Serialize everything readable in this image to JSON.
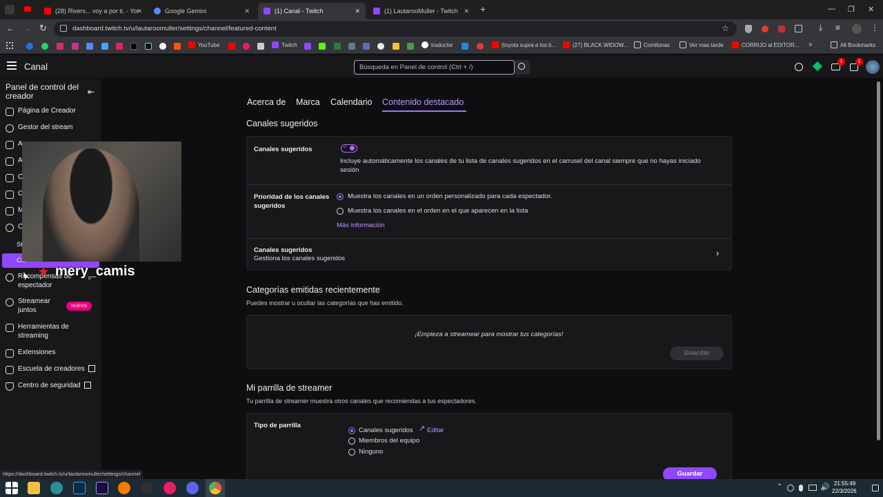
{
  "tabs": [
    {
      "label": "(28) Rivers... voy a por ti. - YouT",
      "color": "#ff0000"
    },
    {
      "label": "Google Gemini",
      "color": "#4f8df7"
    },
    {
      "label": "(1) Canal - Twitch",
      "color": "#9146ff"
    },
    {
      "label": "(1) LautarooMuller - Twitch",
      "color": "#9146ff"
    }
  ],
  "address": "dashboard.twitch.tv/u/lautaroomuller/settings/channel/featured-content",
  "bookmarks": [
    "YouTube",
    "Twitch",
    "traductor",
    "(toyota supra a los ti...",
    "(27) BLACK WIDOW...",
    "Comilonas",
    "Ver mas tarde",
    "CORRIJO al EDITOR...",
    "All Bookmarks"
  ],
  "topnav": {
    "title": "Canal",
    "search_placeholder": "Búsqueda en Panel de control (Ctrl + /)",
    "badge1": "1",
    "badge2": "1"
  },
  "sidebar": {
    "title": "Panel de control del creador",
    "items": [
      "Página de Creador",
      "Gestor del stream",
      "A",
      "A",
      "C",
      "C",
      "M",
      "C",
      "St",
      "Ca",
      "Recompensas de espectador",
      "Streamear juntos",
      "Herramientas de streaming",
      "Extensiones",
      "Escuela de creadores",
      "Centro de seguridad"
    ],
    "new_badge": "NUEVO"
  },
  "overlay_name": "mery_camis",
  "main": {
    "tabs": [
      "Acerca de",
      "Marca",
      "Calendario",
      "Contenido destacado"
    ],
    "section1": {
      "title": "Canales sugeridos",
      "toggle_label": "Canales sugeridos",
      "toggle_desc": "Incluye automáticamente los canales de tu lista de canales sugeridos en el carrusel del canal siempre que no hayas iniciado sesión",
      "priority_label": "Prioridad de los canales sugeridos",
      "opt1": "Muestra los canales en un orden personalizado para cada espectador.",
      "opt2": "Muestra los canales en el orden en el que aparecen en la lista",
      "more": "Más información",
      "manage_title": "Canales sugeridos",
      "manage_sub": "Gestiona los canales sugeridos"
    },
    "section2": {
      "title": "Categorías emitidas recientemente",
      "desc": "Puedes mostrar u ocultar las categorías que has emitido.",
      "empty": "¡Empieza a streamear para mostrar tus categorías!",
      "save": "Guardar"
    },
    "section3": {
      "title": "Mi parrilla de streamer",
      "desc": "Tu parrilla de streamer muestra otros canales que recomiendas a tus espectadores.",
      "type_label": "Tipo de parrilla",
      "opt1": "Canales sugeridos",
      "edit": "Editar",
      "opt2": "Miembros del equipo",
      "opt3": "Ninguno",
      "save": "Guardar"
    }
  },
  "status_url": "https://dashboard.twitch.tv/u/lautaroomuller/settings/channel",
  "clock": {
    "time": "21:55:49",
    "date": "22/3/2026"
  }
}
